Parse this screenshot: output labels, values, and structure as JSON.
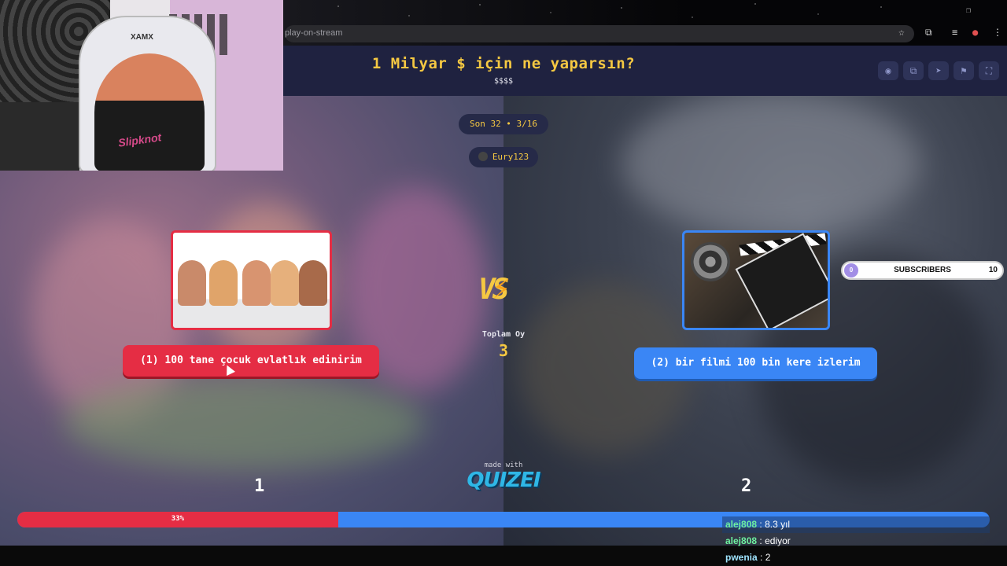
{
  "browser": {
    "url": "play-on-stream",
    "icons": [
      "star-icon",
      "extensions-icon",
      "media-icon",
      "profile-icon",
      "menu-icon"
    ]
  },
  "quiz": {
    "title": "1 Milyar $ için ne yaparsın?",
    "subtitle": "$$$$",
    "round_label": "Son 32 • 3/16",
    "streamer": "Eury123",
    "toolbar_icons": [
      "eye-icon",
      "share-icon",
      "send-icon",
      "flag-icon",
      "fullscreen-icon"
    ],
    "option_left": {
      "label": "(1) 100 tane çocuk evlatlık edinirim",
      "image": "children-photo",
      "color": "#e52d44",
      "number": "1"
    },
    "option_right": {
      "label": "(2) bir filmi 100 bin kere izlerim",
      "image": "film-clapperboard-photo",
      "color": "#3a86f5",
      "number": "2"
    },
    "vs_text": "VS",
    "total_label": "Toplam Oy",
    "total_value": "3",
    "left_percent_label": "33%",
    "left_fraction": 0.33,
    "made_with": "made with",
    "logo": "QUIZEI"
  },
  "subscribers_widget": {
    "start": "0",
    "label": "SUBSCRIBERS",
    "goal": "10",
    "accent": "#a28ee6"
  },
  "webcam": {
    "chair_brand": "XAMX",
    "shirt_text": "Slipknot"
  },
  "chat": [
    {
      "user": "alej808",
      "message": "8.3 yıl"
    },
    {
      "user": "alej808",
      "message": "ediyor"
    },
    {
      "user": "pwenia",
      "message": "2"
    }
  ]
}
